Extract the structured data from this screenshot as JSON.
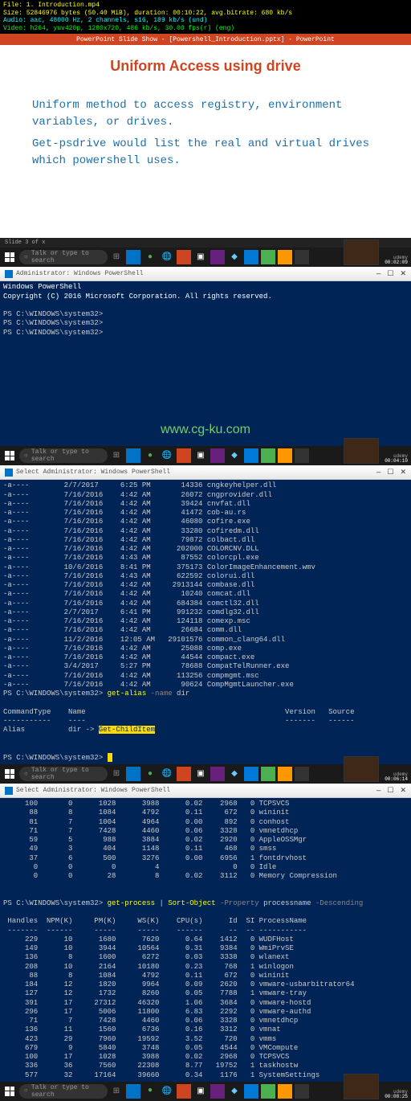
{
  "fileInfo": {
    "file": "File: 1. Introduction.mp4",
    "size": "Size: 52846976 bytes (50.40 MiB), duration: 00:10:22, avg.bitrate: 680 kb/s",
    "audio": "Audio: aac, 48000 Hz, 2 channels, s16, 189 kb/s (und)",
    "video": "Video: h264, yuv420p, 1280x720, 486 kb/s, 30.00 fps(r) (eng)"
  },
  "timestamps": {
    "t1": "00:02:09",
    "t2": "00:04:10",
    "t3": "00:06:14",
    "t4": "00:08:25"
  },
  "udemy": "udemy",
  "powerpoint": {
    "titlebar": "PowerPoint Slide Show - [Powershell_Introduction.pptx] - PowerPoint",
    "slideTitle": "Uniform Access using drive",
    "body1": "Uniform method to access registry, environment variables, or drives.",
    "body2": "Get-psdrive would list the real and virtual drives which powershell uses.",
    "status": "Slide 3 of x"
  },
  "psTitle": "Administrator: Windows PowerShell",
  "psSelectTitle": "Select Administrator: Windows PowerShell",
  "taskbar": {
    "search": "Talk or type to search"
  },
  "watermark": "www.cg-ku.com",
  "ps1": {
    "line1": "Windows PowerShell",
    "line2": "Copyright (C) 2016 Microsoft Corporation. All rights reserved.",
    "blank": "",
    "prompt": "PS C:\\WINDOWS\\system32>"
  },
  "ps2": {
    "rows": [
      [
        "-a----",
        "2/7/2017",
        "6:25 PM",
        "14336",
        "cngkeyhelper.dll"
      ],
      [
        "-a----",
        "7/16/2016",
        "4:42 AM",
        "26072",
        "cngprovider.dll"
      ],
      [
        "-a----",
        "7/16/2016",
        "4:42 AM",
        "39424",
        "cnvfat.dll"
      ],
      [
        "-a----",
        "7/16/2016",
        "4:42 AM",
        "41472",
        "cob-au.rs"
      ],
      [
        "-a----",
        "7/16/2016",
        "4:42 AM",
        "46080",
        "cofire.exe"
      ],
      [
        "-a----",
        "7/16/2016",
        "4:42 AM",
        "33280",
        "cofiredm.dll"
      ],
      [
        "-a----",
        "7/16/2016",
        "4:42 AM",
        "79872",
        "colbact.dll"
      ],
      [
        "-a----",
        "7/16/2016",
        "4:42 AM",
        "202000",
        "COLORCNV.DLL"
      ],
      [
        "-a----",
        "7/16/2016",
        "4:43 AM",
        "87552",
        "colorcpl.exe"
      ],
      [
        "-a----",
        "10/6/2016",
        "8:41 PM",
        "375173",
        "ColorImageEnhancement.wmv"
      ],
      [
        "-a----",
        "7/16/2016",
        "4:43 AM",
        "622592",
        "colorui.dll"
      ],
      [
        "-a----",
        "7/16/2016",
        "4:42 AM",
        "2913144",
        "combase.dll"
      ],
      [
        "-a----",
        "7/16/2016",
        "4:42 AM",
        "10240",
        "comcat.dll"
      ],
      [
        "-a----",
        "7/16/2016",
        "4:42 AM",
        "684384",
        "comctl32.dll"
      ],
      [
        "-a----",
        "2/7/2017",
        "6:41 PM",
        "991232",
        "comdlg32.dll"
      ],
      [
        "-a----",
        "7/16/2016",
        "4:42 AM",
        "124118",
        "comexp.msc"
      ],
      [
        "-a----",
        "7/16/2016",
        "4:42 AM",
        "26684",
        "comm.dll"
      ],
      [
        "-a----",
        "11/2/2016",
        "12:05 AM",
        "29101576",
        "common_clang64.dll"
      ],
      [
        "-a----",
        "7/16/2016",
        "4:42 AM",
        "25088",
        "comp.exe"
      ],
      [
        "-a----",
        "7/16/2016",
        "4:42 AM",
        "44544",
        "compact.exe"
      ],
      [
        "-a----",
        "3/4/2017",
        "5:27 PM",
        "78688",
        "CompatTelRunner.exe"
      ],
      [
        "-a----",
        "7/16/2016",
        "4:42 AM",
        "113256",
        "compmgmt.msc"
      ],
      [
        "-a----",
        "7/16/2016",
        "4:42 AM",
        "90624",
        "CompMgmtLauncher.exe"
      ]
    ],
    "cmdLine": {
      "prompt": "PS C:\\WINDOWS\\system32>",
      "cmd": "get-alias",
      "flag": "-name",
      "arg": "dir"
    },
    "header": {
      "c1": "CommandType",
      "c2": "Name",
      "c3": "Version",
      "c4": "Source"
    },
    "aliasRow": {
      "type": "Alias",
      "name": "dir -> ",
      "sel": "Get-ChildItem"
    },
    "prompt2": "PS C:\\WINDOWS\\system32> "
  },
  "ps3": {
    "top": [
      [
        "100",
        "0",
        "1028",
        "3988",
        "0.02",
        "2968",
        "0",
        "TCPSVCS"
      ],
      [
        "88",
        "8",
        "1084",
        "4792",
        "0.11",
        "672",
        "0",
        "wininit"
      ],
      [
        "81",
        "7",
        "1004",
        "4964",
        "0.00",
        "892",
        "0",
        "conhost"
      ],
      [
        "71",
        "7",
        "7428",
        "4460",
        "0.06",
        "3328",
        "0",
        "vmnetdhcp"
      ],
      [
        "59",
        "5",
        "988",
        "3884",
        "0.02",
        "2920",
        "0",
        "AppleOSSMgr"
      ],
      [
        "49",
        "3",
        "404",
        "1148",
        "0.11",
        "468",
        "0",
        "smss"
      ],
      [
        "37",
        "6",
        "500",
        "3276",
        "0.00",
        "6956",
        "1",
        "fontdrvhost"
      ],
      [
        "0",
        "0",
        "0",
        "4",
        "",
        "0",
        "0",
        "Idle"
      ],
      [
        "0",
        "0",
        "28",
        "8",
        "0.02",
        "3112",
        "0",
        "Memory Compression"
      ]
    ],
    "cmd": {
      "prompt": "PS C:\\WINDOWS\\system32>",
      "p1": "get-process",
      "pipe": " | ",
      "p2": "Sort-Object",
      "flag1": "-Property",
      "arg": "processname",
      "flag2": "-Descending"
    },
    "header": [
      "Handles",
      "NPM(K)",
      "PM(K)",
      "WS(K)",
      "CPU(s)",
      "Id",
      "SI",
      "ProcessName"
    ],
    "rows": [
      [
        "229",
        "10",
        "1680",
        "7620",
        "0.64",
        "1412",
        "0",
        "WUDFHost"
      ],
      [
        "149",
        "10",
        "3944",
        "10564",
        "0.31",
        "9384",
        "0",
        "WmiPrvSE"
      ],
      [
        "136",
        "8",
        "1600",
        "6272",
        "0.03",
        "3338",
        "0",
        "wlanext"
      ],
      [
        "208",
        "10",
        "2164",
        "10180",
        "0.23",
        "768",
        "1",
        "winlogon"
      ],
      [
        "88",
        "8",
        "1084",
        "4792",
        "0.11",
        "672",
        "0",
        "wininit"
      ],
      [
        "184",
        "12",
        "1820",
        "9964",
        "0.09",
        "2620",
        "0",
        "vmware-usbarbitrator64"
      ],
      [
        "127",
        "12",
        "1732",
        "8260",
        "0.05",
        "7788",
        "1",
        "vmware-tray"
      ],
      [
        "391",
        "17",
        "27312",
        "46320",
        "1.06",
        "3684",
        "0",
        "vmware-hostd"
      ],
      [
        "296",
        "17",
        "5006",
        "11800",
        "6.83",
        "2292",
        "0",
        "vmware-authd"
      ],
      [
        "71",
        "7",
        "7428",
        "4460",
        "0.06",
        "3328",
        "0",
        "vmnetdhcp"
      ],
      [
        "136",
        "11",
        "1560",
        "6736",
        "0.16",
        "3312",
        "0",
        "vmnat"
      ],
      [
        "423",
        "29",
        "7960",
        "19592",
        "3.52",
        "720",
        "0",
        "vmms"
      ],
      [
        "679",
        "9",
        "5840",
        "3748",
        "0.05",
        "4544",
        "0",
        "VMCompute"
      ],
      [
        "100",
        "17",
        "1028",
        "3988",
        "0.02",
        "2968",
        "0",
        "TCPSVCS"
      ],
      [
        "336",
        "36",
        "7560",
        "22308",
        "8.77",
        "19752",
        "1",
        "taskhostw"
      ],
      [
        "577",
        "32",
        "17164",
        "39660",
        "0.34",
        "1176",
        "1",
        "SystemSettings"
      ]
    ]
  }
}
